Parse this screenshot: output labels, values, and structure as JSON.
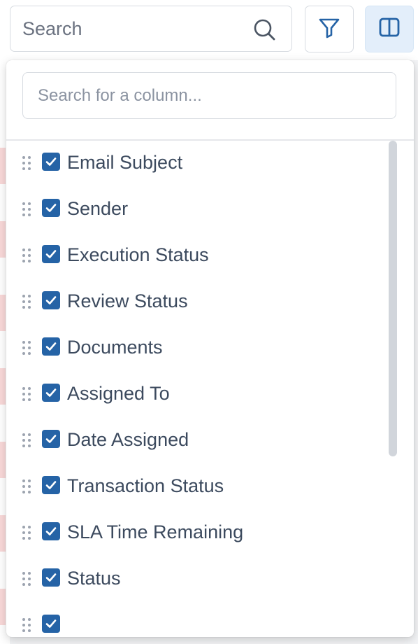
{
  "toolbar": {
    "search_placeholder": "Search",
    "icons": {
      "search": "search-icon",
      "filter": "filter-icon",
      "columns": "columns-icon"
    }
  },
  "column_picker": {
    "search_placeholder": "Search for a column...",
    "items": [
      {
        "label": "Email Subject",
        "checked": true
      },
      {
        "label": "Sender",
        "checked": true
      },
      {
        "label": "Execution Status",
        "checked": true
      },
      {
        "label": "Review Status",
        "checked": true
      },
      {
        "label": "Documents",
        "checked": true
      },
      {
        "label": "Assigned To",
        "checked": true
      },
      {
        "label": "Date Assigned",
        "checked": true
      },
      {
        "label": "Transaction Status",
        "checked": true
      },
      {
        "label": "SLA Time Remaining",
        "checked": true
      },
      {
        "label": "Status",
        "checked": true
      },
      {
        "label": "",
        "checked": true
      }
    ]
  },
  "colors": {
    "accent": "#2563a6",
    "label_text": "#3c4a5e",
    "columns_button_bg": "#e3eefa"
  }
}
